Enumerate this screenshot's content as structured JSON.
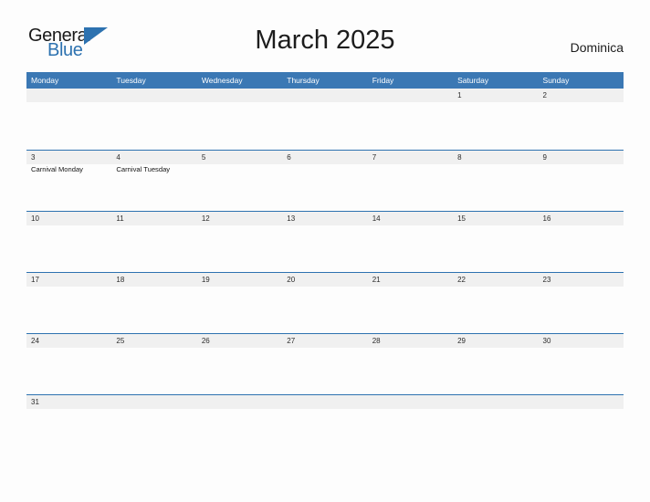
{
  "brand": {
    "name_part1": "General",
    "name_part2": "Blue",
    "flag_icon": "blue-triangle-flag-icon",
    "accent_color": "#2d72b0"
  },
  "header": {
    "title": "March 2025",
    "country": "Dominica"
  },
  "calendar": {
    "header_bg_color": "#3b78b4",
    "band_bg_color": "#f0f0f0",
    "row_border_color": "#2d72b0",
    "weekdays": [
      "Monday",
      "Tuesday",
      "Wednesday",
      "Thursday",
      "Friday",
      "Saturday",
      "Sunday"
    ],
    "weeks": [
      [
        {
          "day": "",
          "events": []
        },
        {
          "day": "",
          "events": []
        },
        {
          "day": "",
          "events": []
        },
        {
          "day": "",
          "events": []
        },
        {
          "day": "",
          "events": []
        },
        {
          "day": "1",
          "events": []
        },
        {
          "day": "2",
          "events": []
        }
      ],
      [
        {
          "day": "3",
          "events": [
            "Carnival Monday"
          ]
        },
        {
          "day": "4",
          "events": [
            "Carnival Tuesday"
          ]
        },
        {
          "day": "5",
          "events": []
        },
        {
          "day": "6",
          "events": []
        },
        {
          "day": "7",
          "events": []
        },
        {
          "day": "8",
          "events": []
        },
        {
          "day": "9",
          "events": []
        }
      ],
      [
        {
          "day": "10",
          "events": []
        },
        {
          "day": "11",
          "events": []
        },
        {
          "day": "12",
          "events": []
        },
        {
          "day": "13",
          "events": []
        },
        {
          "day": "14",
          "events": []
        },
        {
          "day": "15",
          "events": []
        },
        {
          "day": "16",
          "events": []
        }
      ],
      [
        {
          "day": "17",
          "events": []
        },
        {
          "day": "18",
          "events": []
        },
        {
          "day": "19",
          "events": []
        },
        {
          "day": "20",
          "events": []
        },
        {
          "day": "21",
          "events": []
        },
        {
          "day": "22",
          "events": []
        },
        {
          "day": "23",
          "events": []
        }
      ],
      [
        {
          "day": "24",
          "events": []
        },
        {
          "day": "25",
          "events": []
        },
        {
          "day": "26",
          "events": []
        },
        {
          "day": "27",
          "events": []
        },
        {
          "day": "28",
          "events": []
        },
        {
          "day": "29",
          "events": []
        },
        {
          "day": "30",
          "events": []
        }
      ],
      [
        {
          "day": "31",
          "events": []
        },
        {
          "day": "",
          "events": []
        },
        {
          "day": "",
          "events": []
        },
        {
          "day": "",
          "events": []
        },
        {
          "day": "",
          "events": []
        },
        {
          "day": "",
          "events": []
        },
        {
          "day": "",
          "events": []
        }
      ]
    ]
  }
}
